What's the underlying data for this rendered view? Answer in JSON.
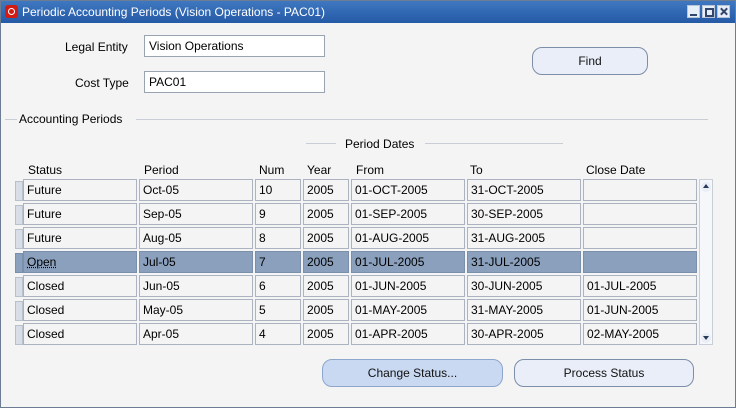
{
  "window": {
    "title": "Periodic Accounting Periods (Vision Operations - PAC01)"
  },
  "form": {
    "legal_entity_label": "Legal Entity",
    "legal_entity_value": "Vision Operations",
    "cost_type_label": "Cost Type",
    "cost_type_value": "PAC01",
    "find_label": "Find"
  },
  "section": {
    "title": "Accounting Periods",
    "period_dates": "Period Dates"
  },
  "table": {
    "headers": [
      "Status",
      "Period",
      "Num",
      "Year",
      "From",
      "To",
      "Close Date"
    ],
    "rows": [
      {
        "status": "Future",
        "period": "Oct-05",
        "num": "10",
        "year": "2005",
        "from": "01-OCT-2005",
        "to": "31-OCT-2005",
        "close": ""
      },
      {
        "status": "Future",
        "period": "Sep-05",
        "num": "9",
        "year": "2005",
        "from": "01-SEP-2005",
        "to": "30-SEP-2005",
        "close": ""
      },
      {
        "status": "Future",
        "period": "Aug-05",
        "num": "8",
        "year": "2005",
        "from": "01-AUG-2005",
        "to": "31-AUG-2005",
        "close": ""
      },
      {
        "status": "Open",
        "period": "Jul-05",
        "num": "7",
        "year": "2005",
        "from": "01-JUL-2005",
        "to": "31-JUL-2005",
        "close": ""
      },
      {
        "status": "Closed",
        "period": "Jun-05",
        "num": "6",
        "year": "2005",
        "from": "01-JUN-2005",
        "to": "30-JUN-2005",
        "close": "01-JUL-2005"
      },
      {
        "status": "Closed",
        "period": "May-05",
        "num": "5",
        "year": "2005",
        "from": "01-MAY-2005",
        "to": "31-MAY-2005",
        "close": "01-JUN-2005"
      },
      {
        "status": "Closed",
        "period": "Apr-05",
        "num": "4",
        "year": "2005",
        "from": "01-APR-2005",
        "to": "30-APR-2005",
        "close": "02-MAY-2005"
      }
    ]
  },
  "actions": {
    "change_status": "Change Status...",
    "process_status": "Process Status"
  }
}
